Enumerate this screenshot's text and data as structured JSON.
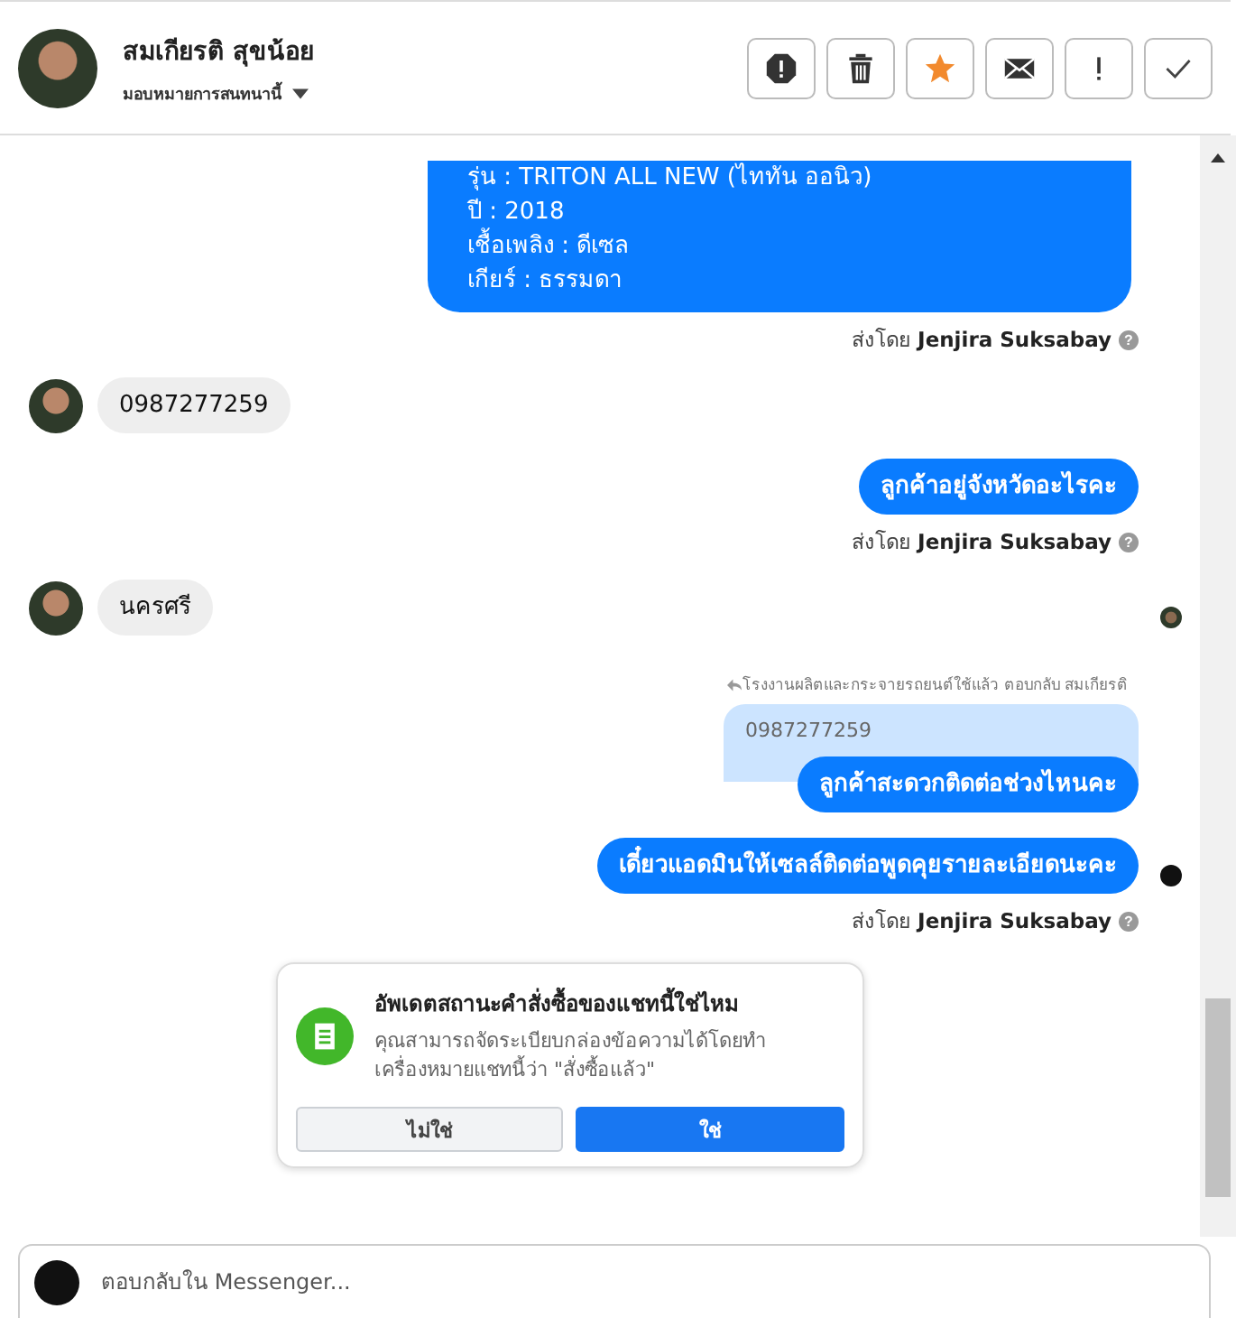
{
  "header": {
    "name": "สมเกียรติ สุขน้อย",
    "assign_label": "มอบหมายการสนทนานี้",
    "actions": [
      {
        "kind": "spam"
      },
      {
        "kind": "trash"
      },
      {
        "kind": "star"
      },
      {
        "kind": "mail"
      },
      {
        "kind": "exclaim"
      },
      {
        "kind": "check"
      }
    ]
  },
  "messages": [
    {
      "kind": "outgoing",
      "lines": [
        "รุ่น : TRITON ALL NEW (ไททัน ออนิว)",
        "ปี : 2018",
        "เชื้อเพลิง : ดีเซล",
        "เกียร์ : ธรรมดา"
      ],
      "seen": false
    },
    {
      "kind": "sent_by",
      "prefix": "ส่งโดย",
      "agent": "Jenjira Suksabay",
      "help": "?"
    },
    {
      "kind": "incoming",
      "lines": [
        "0987277259"
      ],
      "seen": false
    },
    {
      "kind": "outgoing",
      "lines": [
        "ลูกค้าอยู่จังหวัดอะไรคะ"
      ],
      "seen": false
    },
    {
      "kind": "sent_by",
      "prefix": "ส่งโดย",
      "agent": "Jenjira Suksabay",
      "help": "?"
    },
    {
      "kind": "incoming",
      "lines": [
        "นครศรี"
      ],
      "seen": true
    },
    {
      "kind": "reply",
      "note": "โรงงานผลิตและกระจายรถยนต์ใช้แล้ว ตอบกลับ สมเกียรติ",
      "quoted": "0987277259",
      "lines": [
        "ลูกค้าสะดวกติดต่อช่วงไหนคะ"
      ],
      "seen": false
    },
    {
      "kind": "outgoing",
      "lines": [
        "เดี๋ยวแอดมินให้เซลล์ติดต่อพูดคุยรายละเอียดนะคะ"
      ],
      "seen": true
    },
    {
      "kind": "sent_by",
      "prefix": "ส่งโดย",
      "agent": "Jenjira Suksabay",
      "help": "?"
    }
  ],
  "prompt": {
    "title": "อัพเดตสถานะคำสั่งซื้อของแชทนี้ใช่ไหม",
    "body": "คุณสามารถจัดระเบียบกล่องข้อความได้โดยทำเครื่องหมายแชทนี้ว่า \"สั่งซื้อแล้ว\"",
    "buttons": [
      {
        "label": "ไม่ใช่",
        "primary": false
      },
      {
        "label": "ใช่",
        "primary": true
      }
    ]
  },
  "composer": {
    "placeholder": "ตอบกลับใน Messenger..."
  }
}
